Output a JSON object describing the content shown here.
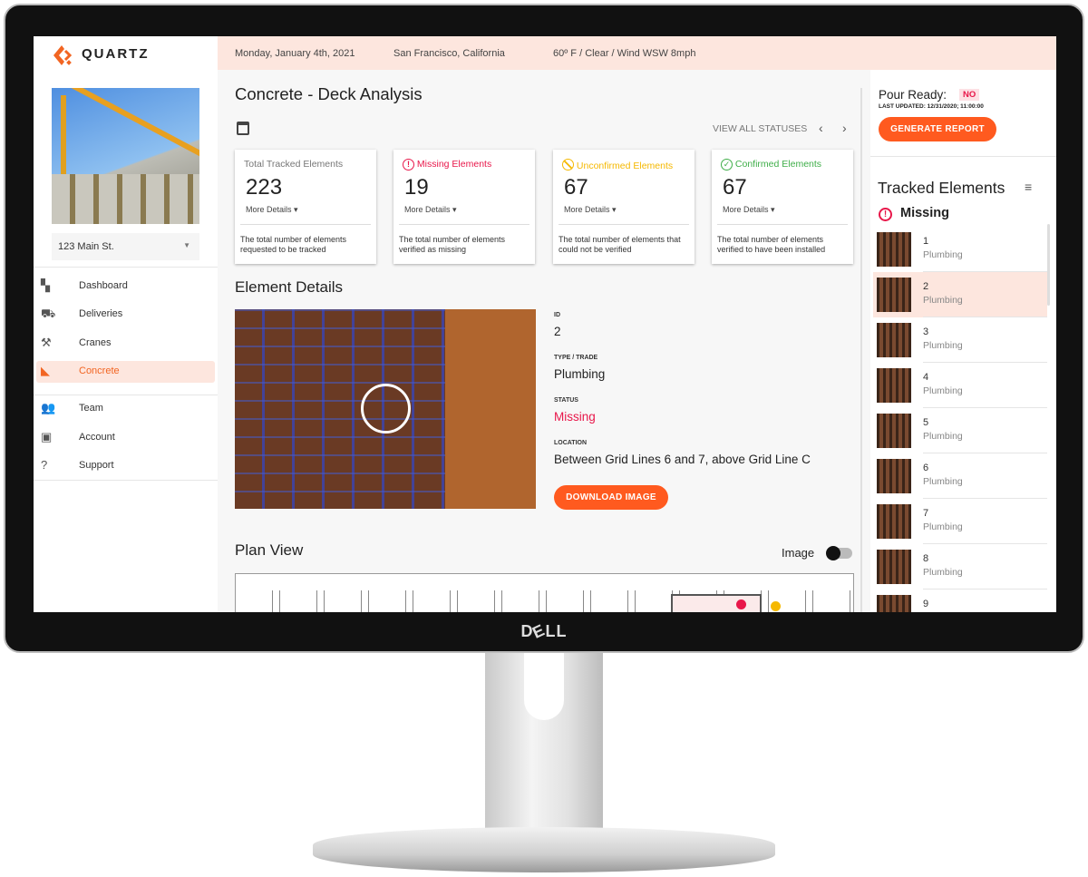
{
  "brand": {
    "name": "QUARTZ",
    "accent": "#ff5a1f"
  },
  "topbar": {
    "date": "Monday, January 4th, 2021",
    "location": "San Francisco, California",
    "weather": "60º F / Clear / Wind WSW 8mph"
  },
  "sidebar": {
    "site_select": "123 Main St.",
    "items": [
      {
        "label": "Dashboard",
        "icon": "dashboard-icon"
      },
      {
        "label": "Deliveries",
        "icon": "truck-icon"
      },
      {
        "label": "Cranes",
        "icon": "crane-icon"
      },
      {
        "label": "Concrete",
        "icon": "concrete-mixer-icon",
        "active": true
      },
      {
        "label": "Team",
        "icon": "team-icon"
      },
      {
        "label": "Account",
        "icon": "account-icon"
      },
      {
        "label": "Support",
        "icon": "help-icon"
      }
    ]
  },
  "main": {
    "title": "Concrete - Deck Analysis",
    "view_all": "VIEW ALL STATUSES",
    "cards": [
      {
        "title": "Total Tracked Elements",
        "value": "223",
        "more": "More Details",
        "desc": "The total number of elements requested to be tracked",
        "color": "#777777"
      },
      {
        "title": "Missing Elements",
        "value": "19",
        "more": "More Details",
        "desc": "The total number of elements verified as missing",
        "color": "#e8174a"
      },
      {
        "title": "Unconfirmed Elements",
        "value": "67",
        "more": "More Details",
        "desc": "The total number of elements that could not be verified",
        "color": "#f5b800"
      },
      {
        "title": "Confirmed Elements",
        "value": "67",
        "more": "More Details",
        "desc": "The total number of elements verified to have been installed",
        "color": "#3fae49"
      }
    ],
    "details": {
      "heading": "Element Details",
      "id_label": "ID",
      "id": "2",
      "type_label": "TYPE / TRADE",
      "type": "Plumbing",
      "status_label": "STATUS",
      "status": "Missing",
      "location_label": "LOCATION",
      "location": "Between Grid Lines 6 and 7, above Grid Line C",
      "download": "DOWNLOAD IMAGE"
    },
    "plan": {
      "heading": "Plan View",
      "toggle_label": "Image",
      "toggle_on": false
    }
  },
  "right": {
    "pour_ready_label": "Pour Ready:",
    "pour_ready": "NO",
    "last_updated": "LAST UPDATED: 12/31/2020; 11:00:00",
    "generate": "GENERATE REPORT",
    "tracked_heading": "Tracked Elements",
    "group": "Missing",
    "items": [
      {
        "id": "1",
        "trade": "Plumbing"
      },
      {
        "id": "2",
        "trade": "Plumbing",
        "selected": true
      },
      {
        "id": "3",
        "trade": "Plumbing"
      },
      {
        "id": "4",
        "trade": "Plumbing"
      },
      {
        "id": "5",
        "trade": "Plumbing"
      },
      {
        "id": "6",
        "trade": "Plumbing"
      },
      {
        "id": "7",
        "trade": "Plumbing"
      },
      {
        "id": "8",
        "trade": "Plumbing"
      },
      {
        "id": "9",
        "trade": "Plumbing"
      }
    ]
  },
  "monitor": {
    "logo": "DELL"
  }
}
